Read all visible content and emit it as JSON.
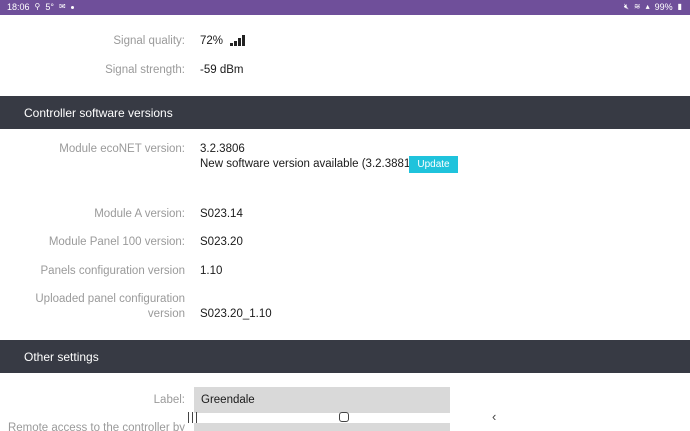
{
  "status_bar": {
    "time": "18:06",
    "temperature": "5°",
    "battery": "99%"
  },
  "network": {
    "signal_quality_label": "Signal quality:",
    "signal_quality_value": "72%",
    "signal_strength_label": "Signal strength:",
    "signal_strength_value": "-59 dBm"
  },
  "controller_versions": {
    "header": "Controller software versions",
    "econet_label": "Module ecoNET version:",
    "econet_value": "3.2.3806",
    "update_notice": "New software version available (3.2.3881)",
    "update_button": "Update",
    "module_a_label": "Module A version:",
    "module_a_value": "S023.14",
    "panel_100_label": "Module Panel 100 version:",
    "panel_100_value": "S023.20",
    "panels_config_label": "Panels configuration version",
    "panels_config_value": "1.10",
    "uploaded_config_label_line1": "Uploaded panel configuration",
    "uploaded_config_label_line2": "version",
    "uploaded_config_value": "S023.20_1.10"
  },
  "other_settings": {
    "header": "Other settings",
    "label_field_label": "Label:",
    "label_field_value": "Greendale",
    "remote_access_label": "Remote access to the controller by"
  },
  "icons": {
    "status_left": [
      "gallery-icon",
      "alarm-icon",
      "mail-icon",
      "dot-icon"
    ],
    "status_right": [
      "mute-icon",
      "wifi-icon",
      "signal-icon",
      "battery-icon"
    ],
    "signal_bars": "signal-bars-icon",
    "nav": [
      "recents-icon",
      "home-icon",
      "back-icon"
    ]
  }
}
